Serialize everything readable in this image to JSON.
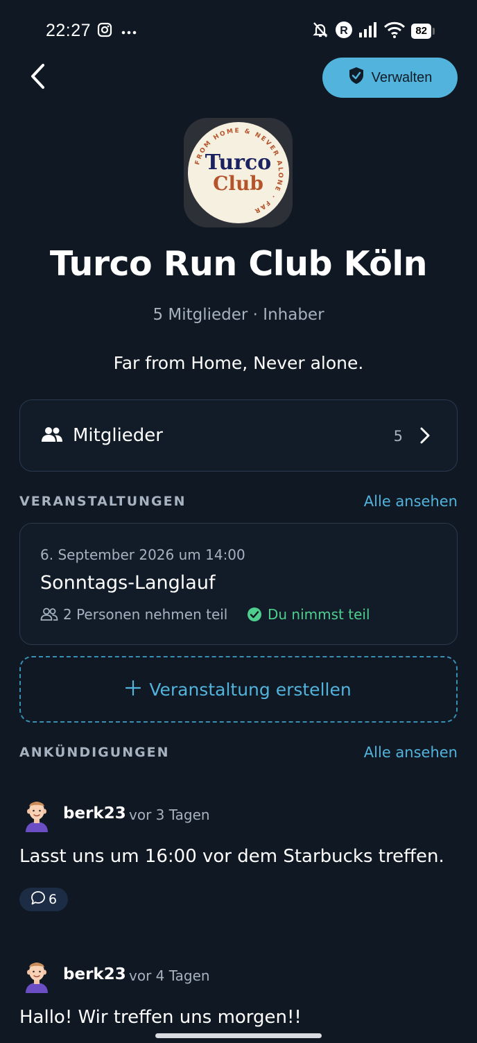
{
  "status": {
    "time": "22:27",
    "battery": "82",
    "left_icons": [
      "instagram-icon",
      "more-icon"
    ],
    "right_icons": [
      "bell-off-icon",
      "r-badge-icon",
      "signal-icon",
      "wifi-icon"
    ]
  },
  "header": {
    "back_icon": "chevron-left-icon",
    "manage_label": "Verwalten",
    "manage_icon": "shield-check-icon"
  },
  "logo": {
    "ring_text": "FROM HOME & NEVER ALONE · FAR",
    "line1": "Turco",
    "line2": "Club"
  },
  "club": {
    "title": "Turco Run Club Köln",
    "meta": "5 Mitglieder · Inhaber",
    "description": "Far from Home, Never alone."
  },
  "members": {
    "label": "Mitglieder",
    "count": "5"
  },
  "events": {
    "heading": "VERANSTALTUNGEN",
    "see_all": "Alle ansehen",
    "items": [
      {
        "date": "6. September 2026 um 14:00",
        "name": "Sonntags-Langlauf",
        "participants": "2 Personen nehmen teil",
        "status": "Du nimmst teil"
      }
    ],
    "create_label": "Veranstaltung erstellen"
  },
  "announcements": {
    "heading": "ANKÜNDIGUNGEN",
    "see_all": "Alle ansehen",
    "items": [
      {
        "user": "berk23",
        "time": "vor 3 Tagen",
        "text": "Lasst uns um 16:00 vor dem Starbucks treffen.",
        "comments": "6"
      },
      {
        "user": "berk23",
        "time": "vor 4 Tagen",
        "text": "Hallo! Wir treffen uns morgen!!"
      }
    ]
  },
  "colors": {
    "background": "#0f1823",
    "accent": "#52b3dc",
    "success": "#4fcf8d",
    "muted": "#a7b2c0",
    "card_border": "#2b3a4d"
  }
}
